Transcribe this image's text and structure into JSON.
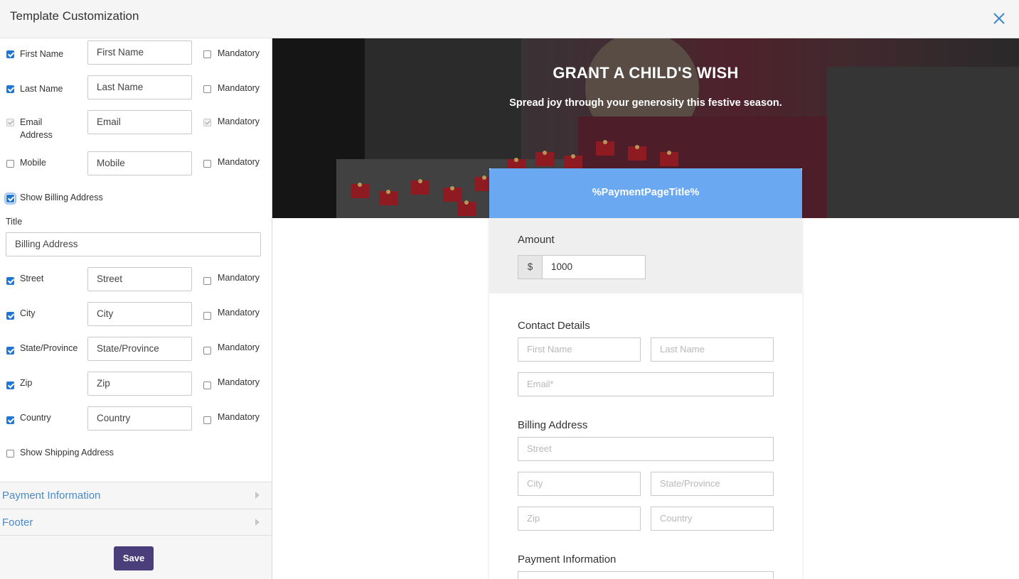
{
  "header": {
    "title": "Template Customization",
    "close_icon": "close-icon"
  },
  "fields": [
    {
      "label": "First Name",
      "placeholder": "First Name",
      "mandatory_label": "Mandatory"
    },
    {
      "label": "Last Name",
      "placeholder": "Last Name",
      "mandatory_label": "Mandatory"
    },
    {
      "label": "Email Address",
      "placeholder": "Email",
      "mandatory_label": "Mandatory"
    },
    {
      "label": "Mobile",
      "placeholder": "Mobile",
      "mandatory_label": "Mandatory"
    }
  ],
  "billing": {
    "toggle_label": "Show Billing Address",
    "title_label": "Title",
    "title_value": "Billing Address",
    "fields": [
      {
        "label": "Street",
        "placeholder": "Street",
        "mandatory_label": "Mandatory"
      },
      {
        "label": "City",
        "placeholder": "City",
        "mandatory_label": "Mandatory"
      },
      {
        "label": "State/Province",
        "placeholder": "State/Province",
        "mandatory_label": "Mandatory"
      },
      {
        "label": "Zip",
        "placeholder": "Zip",
        "mandatory_label": "Mandatory"
      },
      {
        "label": "Country",
        "placeholder": "Country",
        "mandatory_label": "Mandatory"
      }
    ]
  },
  "shipping": {
    "toggle_label": "Show Shipping Address"
  },
  "accordion": [
    {
      "label": "Payment Information"
    },
    {
      "label": "Footer"
    }
  ],
  "save_label": "Save",
  "preview": {
    "banner_title": "GRANT A CHILD'S WISH",
    "banner_subtitle": "Spread joy through your generosity this festive season.",
    "page_title": "%PaymentPageTitle%",
    "amount_label": "Amount",
    "currency": "$",
    "amount_value": "1000",
    "contact_title": "Contact Details",
    "contact_placeholders": {
      "first": "First Name",
      "last": "Last Name",
      "email": "Email*"
    },
    "billing_title": "Billing Address",
    "billing_placeholders": {
      "street": "Street",
      "city": "City",
      "state": "State/Province",
      "zip": "Zip",
      "country": "Country"
    },
    "payment_title": "Payment Information"
  },
  "colors": {
    "accent": "#1f77d4",
    "header_blue": "#6aa9f2",
    "save_button": "#4a3f7a",
    "link": "#4a8ac6"
  }
}
